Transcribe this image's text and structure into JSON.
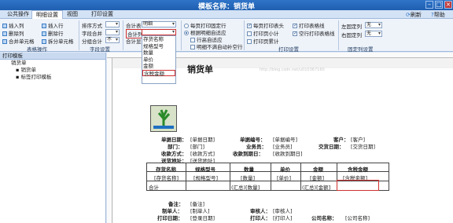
{
  "window": {
    "title": "模板名称：销货单"
  },
  "menu": {
    "tabs": [
      "公共操作",
      "明细设置",
      "视图",
      "打印设置"
    ],
    "active": 1,
    "refresh": "刷新",
    "help": "帮助"
  },
  "ribbon": {
    "table_ops": {
      "insert_col": "插入列",
      "insert_row": "插入行",
      "delete_col": "删除列",
      "delete_row": "删除行",
      "merge": "合并单元格",
      "split": "拆分单元格",
      "label": "表格操作"
    },
    "field": {
      "sort_label": "排序方式",
      "field_merge": "字段合并",
      "group_by": "分组合计",
      "group_val": "不",
      "label": "字段设置"
    },
    "totals": {
      "total_table_label": "合计表",
      "total_table_val": "明细",
      "total_col_label": "合计列",
      "total_col_val": "",
      "footer_label": "合计显"
    },
    "dropdown_options": [
      "存货名称",
      "规格型号",
      "数量",
      "单价",
      "金额",
      "含税金额"
    ],
    "dropdown_highlight": 5,
    "pageopts": {
      "print_fixed": "每页打印固定行",
      "by_detail": "根据明细自适应",
      "row_adaptive": "行高自适应",
      "detail_no_fill": "明细不满自动补空行"
    },
    "print": {
      "print_header": "每页打印表头",
      "print_table_lines": "打印表格线",
      "page_subtotal": "打印页小计",
      "empty_row_lines": "空行打印表格线",
      "page_total": "打印页累计",
      "label": "打印设置"
    },
    "fixed": {
      "left_fixed": "左固定列",
      "left_val": "无",
      "right_fixed": "右固定列",
      "right_val": "无",
      "label": "固定列设置"
    }
  },
  "left": {
    "header": "打印模板",
    "tree": [
      "销货单",
      "销货单",
      "标签打印模板"
    ]
  },
  "report": {
    "title": "销货单",
    "watermark": "http://blog.csdn.net/u010367160",
    "fields": [
      [
        "单据日期：",
        "[单据日期]"
      ],
      [
        "单据编号：",
        "[单据编号]"
      ],
      [
        "客户：",
        "[客户]"
      ],
      [
        "部门：",
        "[部门]"
      ],
      [
        "业务员：",
        "[业务员]"
      ],
      [
        "交货日期：",
        "[交货日期]"
      ],
      [
        "收款方式：",
        "[收款方式]"
      ],
      [
        "收款到期日：",
        "[收款到期日]"
      ],
      [
        "送货地址：",
        "[送货地址]"
      ]
    ],
    "table_headers": [
      "存货名称",
      "规格型号",
      "数量",
      "单价",
      "金额",
      "含税金额"
    ],
    "table_row": [
      "[存货名称]",
      "[规格型号]",
      "[数量]",
      "[单价]",
      "[金额]",
      "[含税金额]"
    ],
    "total_label": "合计",
    "total_qty": "(汇总)[数量]",
    "total_amt": "(汇总)[金额]",
    "footer": [
      [
        "备注：",
        "[备注]"
      ],
      [
        "制单人：",
        "[制单人]"
      ],
      [
        "审核人：",
        "[审核人]"
      ],
      [
        "打印日期：",
        "[登录日期]"
      ],
      [
        "打印人：",
        "[打印人]"
      ],
      [
        "公司名称：",
        "[公司名称]"
      ]
    ]
  }
}
